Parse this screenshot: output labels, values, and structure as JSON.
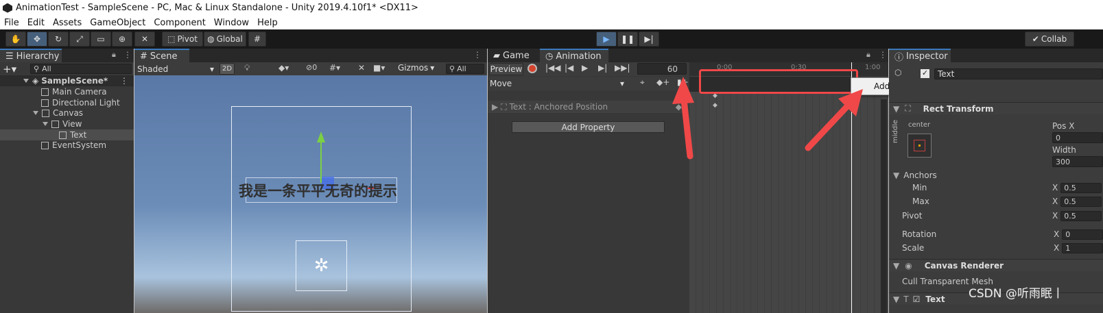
{
  "window": {
    "title": "AnimationTest - SampleScene - PC, Mac & Linux Standalone - Unity 2019.4.10f1* <DX11>"
  },
  "menu": {
    "items": [
      "File",
      "Edit",
      "Assets",
      "GameObject",
      "Component",
      "Window",
      "Help"
    ]
  },
  "toolbar": {
    "pivot": "Pivot",
    "global": "Global",
    "collab": "Collab"
  },
  "hierarchy": {
    "tab": "Hierarchy",
    "search_placeholder": "All",
    "items": [
      {
        "label": "SampleScene*"
      },
      {
        "label": "Main Camera"
      },
      {
        "label": "Directional Light"
      },
      {
        "label": "Canvas"
      },
      {
        "label": "View"
      },
      {
        "label": "Text"
      },
      {
        "label": "EventSystem"
      }
    ]
  },
  "scene": {
    "tab": "Scene",
    "shading": "Shaded",
    "mode2d": "2D",
    "hidden_count": "0",
    "gizmos": "Gizmos",
    "search_placeholder": "All",
    "text": "我是一条平平无奇的提示"
  },
  "animation": {
    "tab_game": "Game",
    "tab_animation": "Animation",
    "preview": "Preview",
    "frame": "60",
    "clip": "Move",
    "property": "Text : Anchored Position",
    "add_property": "Add Property",
    "time_labels": [
      "0:00",
      "0:30",
      "1:00"
    ],
    "context_menu_item": "Add Animation Event"
  },
  "inspector": {
    "tab": "Inspector",
    "object_name": "Text",
    "rect_transform": "Rect Transform",
    "anchor_preset_h": "center",
    "anchor_preset_v": "middle",
    "pos_x_label": "Pos X",
    "pos_x": "0",
    "width_label": "Width",
    "width": "300",
    "anchors": "Anchors",
    "min": "Min",
    "max": "Max",
    "min_x": "0.5",
    "max_x": "0.5",
    "pivot": "Pivot",
    "pivot_x": "0.5",
    "rotation": "Rotation",
    "rotation_x": "0",
    "scale": "Scale",
    "scale_x": "1",
    "x": "X",
    "canvas_renderer": "Canvas Renderer",
    "cull": "Cull Transparent Mesh",
    "text_comp": "Text"
  },
  "watermark": "CSDN @听雨眠丨"
}
